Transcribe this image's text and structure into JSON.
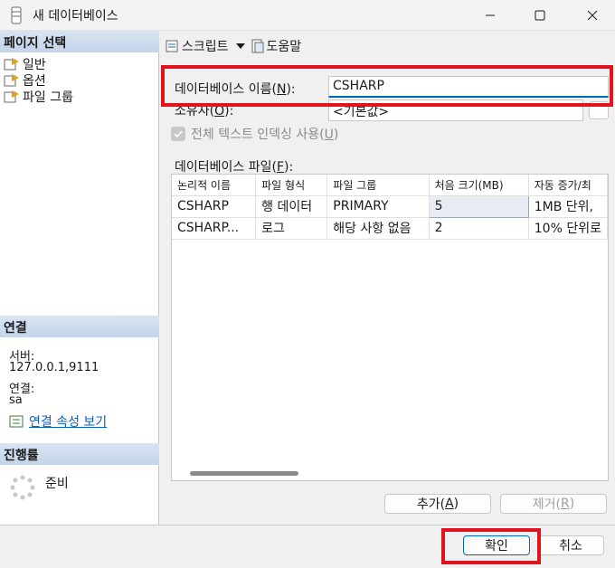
{
  "window": {
    "title": "새 데이터베이스",
    "icons": [
      "database-icon",
      "minimize-icon",
      "maximize-icon",
      "close-icon"
    ]
  },
  "left_pane": {
    "page_select_header": "페이지 선택",
    "pages": [
      {
        "label": "일반",
        "icon": "page-icon"
      },
      {
        "label": "옵션",
        "icon": "page-icon"
      },
      {
        "label": "파일 그룹",
        "icon": "page-icon"
      }
    ],
    "connection_header": "연결",
    "server_label": "서버:",
    "server_value": "127.0.0.1,9111",
    "connection_label": "연결:",
    "connection_value": "sa",
    "view_properties_link": "연결 속성 보기",
    "progress_header": "진행률",
    "progress_status": "준비"
  },
  "toolbar": {
    "script_label": "스크립트",
    "help_label": "도움말"
  },
  "form": {
    "db_name_label_prefix": "데이터베이스 이름(",
    "db_name_label_key": "N",
    "db_name_label_suffix": "):",
    "db_name_value": "CSHARP",
    "owner_label_prefix": "소유자(",
    "owner_label_key": "O",
    "owner_label_suffix": "):",
    "owner_value": "<기본값>",
    "fulltext_label_prefix": "전체 텍스트 인덱싱 사용(",
    "fulltext_label_key": "U",
    "fulltext_label_suffix": ")",
    "fulltext_checked": true,
    "files_label_prefix": "데이터베이스 파일(",
    "files_label_key": "F",
    "files_label_suffix": "):"
  },
  "files_table": {
    "columns": [
      "논리적 이름",
      "파일 형식",
      "파일 그룹",
      "처음 크기(MB)",
      "자동 증가/최"
    ],
    "rows": [
      [
        "CSHARP",
        "행 데이터",
        "PRIMARY",
        "5",
        "1MB 단위,"
      ],
      [
        "CSHARP...",
        "로그",
        "해당 사항 없음",
        "2",
        "10% 단위로"
      ]
    ]
  },
  "grid_buttons": {
    "add_prefix": "추가(",
    "add_key": "A",
    "add_suffix": ")",
    "remove_prefix": "제거(",
    "remove_key": "R",
    "remove_suffix": ")"
  },
  "dialog_buttons": {
    "ok": "확인",
    "cancel": "취소"
  },
  "colors": {
    "highlight": "#e0141e",
    "accent": "#0067c0",
    "section_header": "#c3d5ea"
  }
}
